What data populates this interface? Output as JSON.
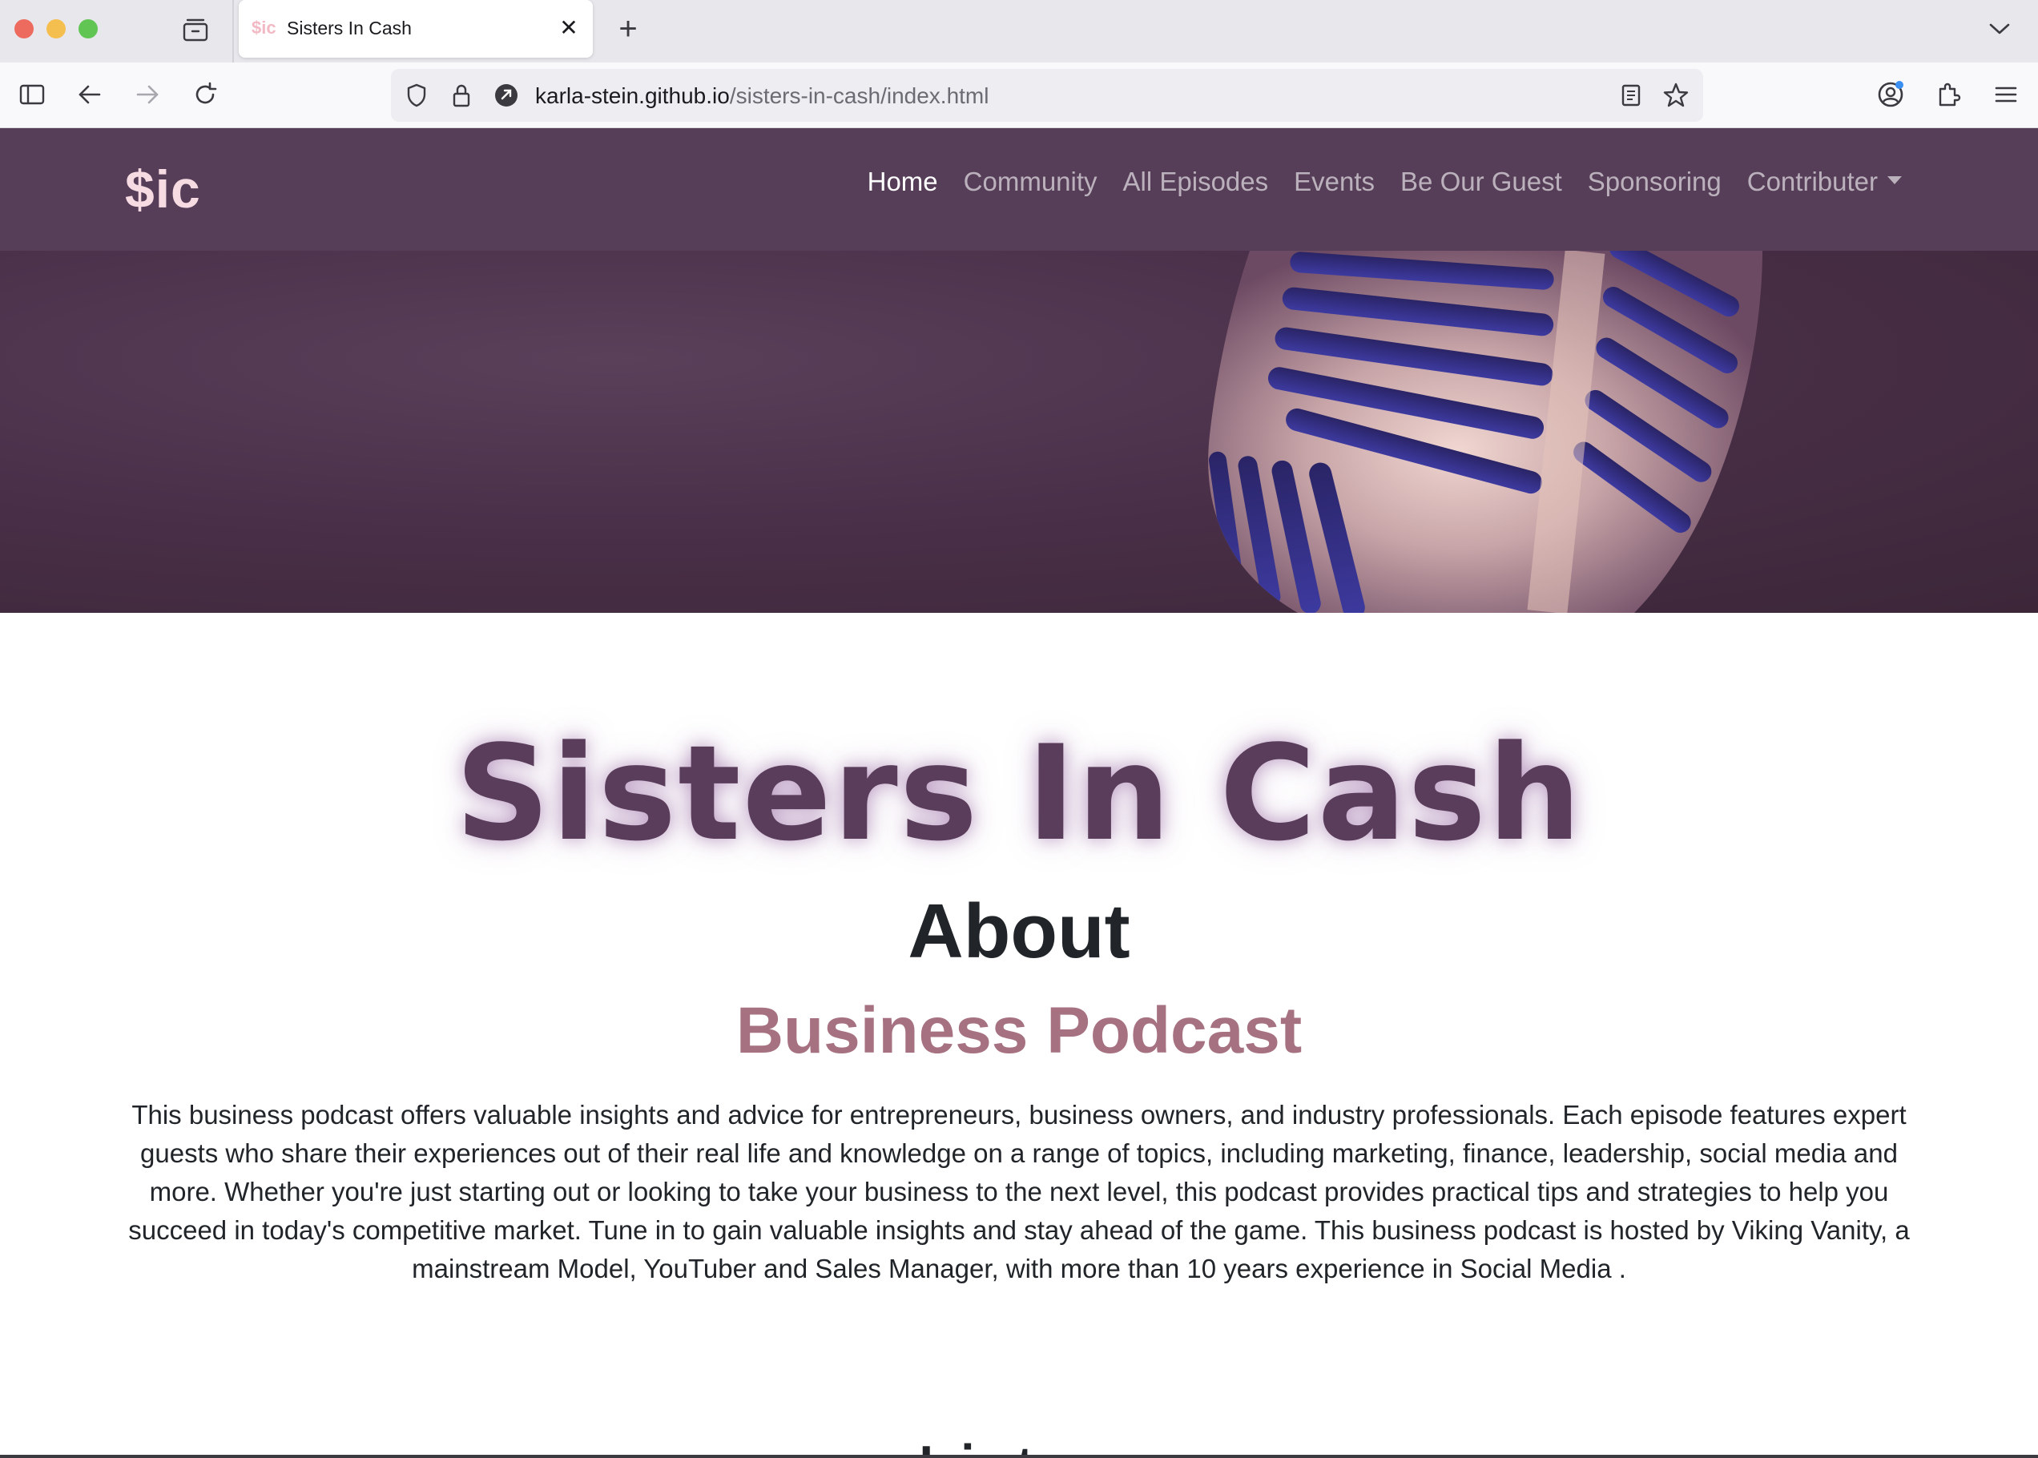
{
  "browser": {
    "tab": {
      "favicon": "$ic",
      "title": "Sisters In Cash",
      "close": "✕"
    },
    "new_tab": "+",
    "url": {
      "host": "karla-stein.github.io",
      "path": "/sisters-in-cash/index.html"
    }
  },
  "site": {
    "brand": "$ic",
    "nav": [
      {
        "label": "Home",
        "active": true
      },
      {
        "label": "Community"
      },
      {
        "label": "All Episodes"
      },
      {
        "label": "Events"
      },
      {
        "label": "Be Our Guest"
      },
      {
        "label": "Sponsoring"
      },
      {
        "label": "Contributer",
        "dropdown": true
      }
    ]
  },
  "hero": {
    "image": "microphone-image"
  },
  "content": {
    "title": "Sisters In Cash",
    "about": "About",
    "subtitle": "Business Podcast",
    "paragraph": "This business podcast offers valuable insights and advice for entrepreneurs, business owners, and industry professionals. Each episode features expert guests who share their experiences out of their real life and knowledge on a range of topics, including marketing, finance, leadership, social media and more. Whether you're just starting out or looking to take your business to the next level, this podcast provides practical tips and strategies to help you succeed in today's competitive market. Tune in to gain valuable insights and stay ahead of the game. This business podcast is hosted by Viking Vanity, a mainstream Model, YouTuber and Sales Manager, with more than 10 years experience in Social Media .",
    "next_heading_partial": "Listen"
  },
  "colors": {
    "nav_bg": "#563d58",
    "brand": "#f7dbe3",
    "title": "#5a3c5b",
    "subtitle": "#a67281"
  }
}
